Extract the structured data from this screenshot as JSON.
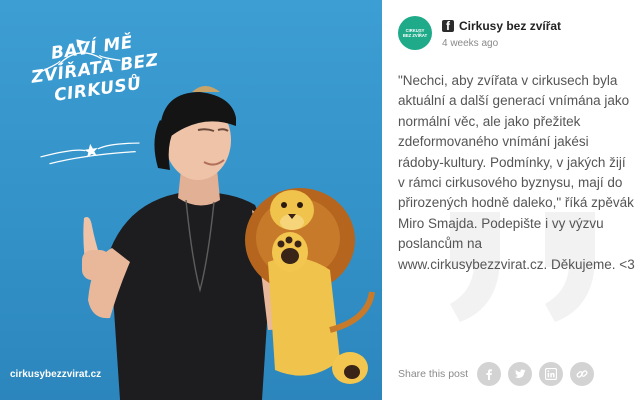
{
  "image": {
    "slogan_lines": [
      "Baví mě",
      "zvířata bez",
      "cirkusů"
    ],
    "watermark": "cirkusybezzvirat.cz"
  },
  "post": {
    "avatar_text": "Cirkusy bez zvířat",
    "author": "Cirkusy bez zvířat",
    "time": "4 weeks ago",
    "message_lines": [
      "\"Nechci, aby zvířata v cirkusech byla",
      "aktuální a další generací vnímána jako",
      "normální věc, ale jako přežitek",
      "zdeformovaného vnímání jakési",
      "rádoby-kultury. Podmínky, v jakých žijí",
      "v rámci cirkusového byznysu, mají do",
      "přirozených hodně daleko,\" říká zpěvák",
      "Miro Smajda. Podepište i vy výzvu",
      "poslancům na",
      "www.cirkusybezzvirat.cz. Děkujeme. <3"
    ],
    "share_label": "Share this post",
    "share_icons": [
      "facebook-icon",
      "twitter-icon",
      "linkedin-icon",
      "link-icon"
    ]
  },
  "colors": {
    "photo_bg": "#3392c8",
    "brand_green": "#1faa8a",
    "share_button": "#d3d3d3",
    "text": "#555555"
  }
}
